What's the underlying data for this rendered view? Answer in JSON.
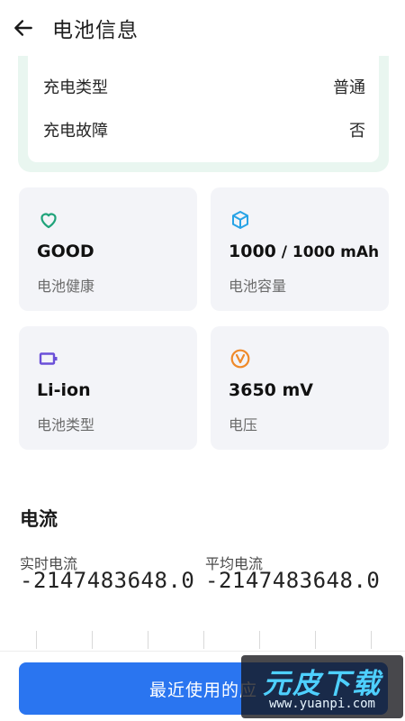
{
  "header": {
    "title": "电池信息"
  },
  "charge": {
    "rows": [
      {
        "label": "充电类型",
        "value": "普通"
      },
      {
        "label": "充电故障",
        "value": "否"
      }
    ]
  },
  "stats": [
    {
      "icon": "heart-icon",
      "icon_color": "#1fa37a",
      "value": "GOOD",
      "label": "电池健康"
    },
    {
      "icon": "cube-icon",
      "icon_color": "#27a3e6",
      "value_main": "1000",
      "value_rest": " / 1000 mAh",
      "label": "电池容量"
    },
    {
      "icon": "battery-icon",
      "icon_color": "#6a4fd8",
      "value": "Li-ion",
      "label": "电池类型"
    },
    {
      "icon": "voltage-icon",
      "icon_color": "#ef8a2a",
      "value": "3650 mV",
      "label": "电压"
    }
  ],
  "current": {
    "title": "电流",
    "realtime_label": "实时电流",
    "realtime_value": "-2147483648.0",
    "average_label": "平均电流",
    "average_value": "-2147483648.0"
  },
  "bottom": {
    "button_label": "最近使用的应"
  },
  "watermark": {
    "text": "元皮下载",
    "url": "www.yuanpi.com"
  },
  "colors": {
    "accent": "#2a75f0",
    "card_bg": "#f3f4f8",
    "charge_bg": "#e9f6f0"
  }
}
